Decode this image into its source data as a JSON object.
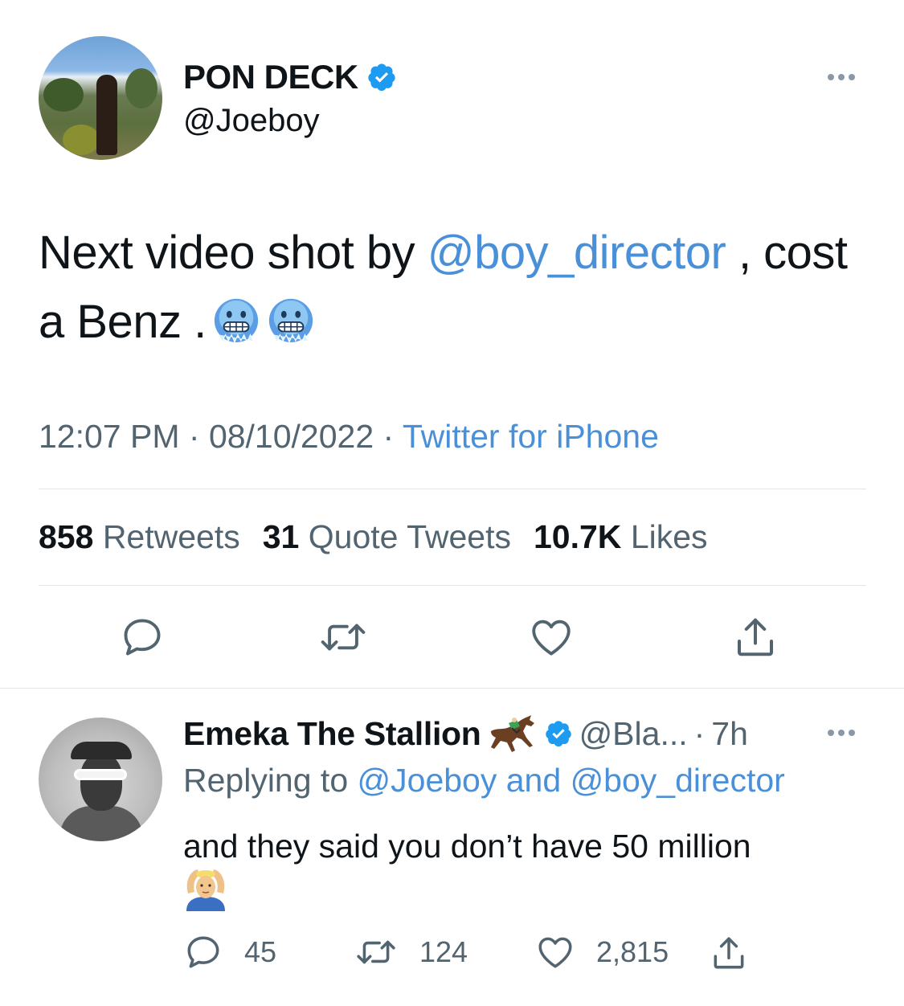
{
  "tweet": {
    "display_name": "PON DECK",
    "handle": "@Joeboy",
    "text_before": "Next video shot by ",
    "mention": "@boy_director",
    "text_after": " , cost a Benz .",
    "time": "12:07 PM",
    "date": "08/10/2022",
    "source": "Twitter for iPhone",
    "separator": " · ",
    "stats": {
      "retweets_count": "858",
      "retweets_label": "Retweets",
      "quotes_count": "31",
      "quotes_label": "Quote Tweets",
      "likes_count": "10.7K",
      "likes_label": "Likes"
    },
    "emoji": [
      "cold-face-emoji",
      "cold-face-emoji"
    ]
  },
  "reply": {
    "display_name": "Emeka The Stallion",
    "name_emoji": "horse-racing-emoji",
    "handle": "@Bla...",
    "time": "7h",
    "replying_prefix": "Replying to ",
    "replying_user1": "@Joeboy",
    "replying_and": " and ",
    "replying_user2": "@boy_director",
    "text": "and they said you don’t have 50 million",
    "text_emoji": "person-gesturing-ok-emoji",
    "counts": {
      "replies": "45",
      "retweets": "124",
      "likes": "2,815"
    }
  },
  "colors": {
    "accent": "#4a90d9",
    "verified": "#1d9bf0",
    "text": "#0f1419",
    "secondary": "#536471",
    "divider": "#e1e6ea"
  }
}
